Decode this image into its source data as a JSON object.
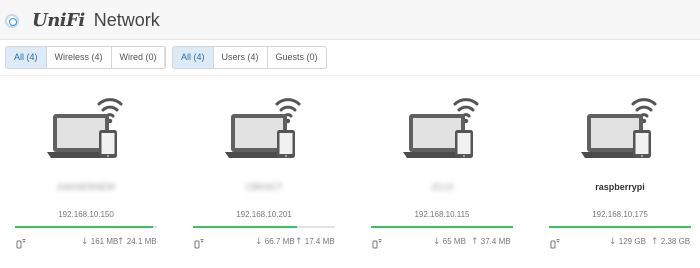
{
  "header": {
    "logo_text": "UniFi",
    "app_name": "Network"
  },
  "filters": {
    "connection": [
      {
        "label": "All (4)",
        "active": true
      },
      {
        "label": "Wireless (4)",
        "active": false
      },
      {
        "label": "Wired (0)",
        "active": false
      }
    ],
    "type": [
      {
        "label": "All (4)",
        "active": true
      },
      {
        "label": "Users (4)",
        "active": false
      },
      {
        "label": "Guests (0)",
        "active": false
      }
    ]
  },
  "clients": [
    {
      "name": "AAKNERNEW",
      "name_blurred": true,
      "ip": "192.168.10.150",
      "signal": 0.97,
      "download": "161 MB",
      "upload": "24.1 MB",
      "icon": "laptop-wifi-icon"
    },
    {
      "name": "CBKNCT",
      "name_blurred": true,
      "ip": "192.168.10.201",
      "signal": 0.73,
      "download": "66.7 MB",
      "upload": "17.4 MB",
      "icon": "laptop-wifi-icon"
    },
    {
      "name": "JCLD",
      "name_blurred": true,
      "ip": "192.168.10.115",
      "signal": 1.0,
      "download": "65 MB",
      "upload": "37.4 MB",
      "icon": "laptop-wifi-icon"
    },
    {
      "name": "raspberrypi",
      "name_blurred": false,
      "ip": "192.168.10.175",
      "signal": 1.0,
      "download": "129 GB",
      "upload": "2.38 GB",
      "icon": "laptop-wifi-icon"
    }
  ],
  "colors": {
    "accent": "#2b9fd9",
    "active_filter_bg": "#dcebf7",
    "signal_good": "#3cc262"
  }
}
